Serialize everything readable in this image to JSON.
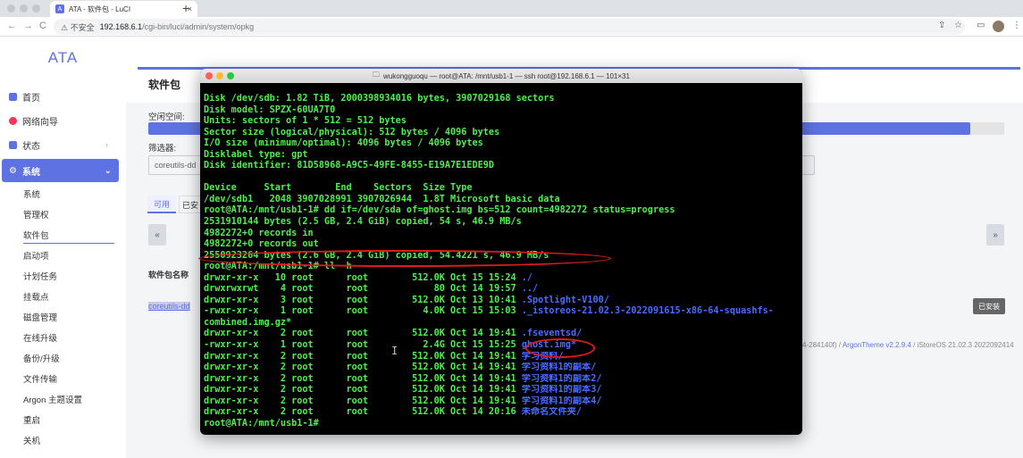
{
  "browser": {
    "tab_title": "ATA - 软件包 - LuCI",
    "favicon": "A",
    "close": "×",
    "new_tab": "+",
    "nav": {
      "back": "←",
      "forward": "→",
      "reload": "C"
    },
    "security_label": "⚠ 不安全",
    "url_host": "192.168.6.1",
    "url_path": "/cgi-bin/luci/admin/system/opkg",
    "icons": [
      "share-icon",
      "star-icon",
      "sidebar-icon",
      "profile-avatar",
      "menu-icon"
    ]
  },
  "sidebar": {
    "brand": "ATA",
    "top_items": [
      {
        "label": "首页",
        "icon": "home-icon",
        "color": "#5e72e4"
      },
      {
        "label": "网络向导",
        "icon": "wizard-icon",
        "color": "#f5365c"
      },
      {
        "label": "状态",
        "icon": "status-icon",
        "color": "#5e72e4"
      }
    ],
    "active_section": "系统",
    "sub_items": [
      "系统",
      "管理权",
      "软件包",
      "启动项",
      "计划任务",
      "挂载点",
      "磁盘管理",
      "在线升级",
      "备份/升级",
      "文件传输",
      "Argon 主题设置",
      "重启",
      "关机"
    ],
    "active_sub": "软件包"
  },
  "main": {
    "title": "软件包",
    "free_space_label": "空闲空间:",
    "free_space_fraction": 0.96,
    "filter_label": "筛选器:",
    "filter_value": "coreutils-dd",
    "tab_available": "可用",
    "tab_installed": "已安",
    "pager_prev": "«",
    "pager_next": "»",
    "col_name": "软件包名称",
    "row_package": "coreutils-dd",
    "installed_badge": "已安装",
    "footer_link": "4-284140f)",
    "footer_theme": "ArgonTheme v2.2.9.4",
    "footer_os": "iStoreOS 21.02.3 2022092414",
    "footer_sep": " / "
  },
  "terminal": {
    "title": "wukongguoqu — root@ATA: /mnt/usb1-1 — ssh root@192.168.6.1 — 101×31",
    "lines": [
      "Disk /dev/sdb: 1.82 TiB, 2000398934016 bytes, 3907029168 sectors",
      "Disk model: SPZX-60UA7T0",
      "Units: sectors of 1 * 512 = 512 bytes",
      "Sector size (logical/physical): 512 bytes / 4096 bytes",
      "I/O size (minimum/optimal): 4096 bytes / 4096 bytes",
      "Disklabel type: gpt",
      "Disk identifier: 81D58968-A9C5-49FE-8455-E19A7E1EDE9D",
      "",
      "Device     Start        End    Sectors  Size Type",
      "/dev/sdb1   2048 3907028991 3907026944  1.8T Microsoft basic data",
      "root@ATA:/mnt/usb1-1# dd if=/dev/sda of=ghost.img bs=512 count=4982272 status=progress",
      "2531910144 bytes (2.5 GB, 2.4 GiB) copied, 54 s, 46.9 MB/s",
      "4982272+0 records in",
      "4982272+0 records out",
      "2550923264 bytes (2.6 GB, 2.4 GiB) copied, 54.4221 s, 46.9 MB/s",
      "root@ATA:/mnt/usb1-1# ll -h"
    ],
    "listing": [
      {
        "perm": "drwxr-xr-x",
        "n": "10",
        "u": "root",
        "g": "root",
        "size": "512.0K",
        "date": "Oct 15 15:24",
        "name": "./"
      },
      {
        "perm": "drwxrwxrwt",
        "n": "4",
        "u": "root",
        "g": "root",
        "size": "80",
        "date": "Oct 14 19:57",
        "name": "../"
      },
      {
        "perm": "drwxr-xr-x",
        "n": "3",
        "u": "root",
        "g": "root",
        "size": "512.0K",
        "date": "Oct 13 10:41",
        "name": ".Spotlight-V100/"
      },
      {
        "perm": "-rwxr-xr-x",
        "n": "1",
        "u": "root",
        "g": "root",
        "size": "4.0K",
        "date": "Oct 15 15:03",
        "name": "._istoreos-21.02.3-2022091615-x86-64-squashfs-"
      },
      {
        "perm": "combined.img.gz*",
        "n": "",
        "u": "",
        "g": "",
        "size": "",
        "date": "",
        "name": ""
      },
      {
        "perm": "drwxr-xr-x",
        "n": "2",
        "u": "root",
        "g": "root",
        "size": "512.0K",
        "date": "Oct 14 19:41",
        "name": ".fseventsd/"
      },
      {
        "perm": "-rwxr-xr-x",
        "n": "1",
        "u": "root",
        "g": "root",
        "size": "2.4G",
        "date": "Oct 15 15:25",
        "name": "ghost.img*"
      },
      {
        "perm": "drwxr-xr-x",
        "n": "2",
        "u": "root",
        "g": "root",
        "size": "512.0K",
        "date": "Oct 14 19:41",
        "name": "学习资料/"
      },
      {
        "perm": "drwxr-xr-x",
        "n": "2",
        "u": "root",
        "g": "root",
        "size": "512.0K",
        "date": "Oct 14 19:41",
        "name": "学习资料1的副本/"
      },
      {
        "perm": "drwxr-xr-x",
        "n": "2",
        "u": "root",
        "g": "root",
        "size": "512.0K",
        "date": "Oct 14 19:41",
        "name": "学习资料1的副本2/"
      },
      {
        "perm": "drwxr-xr-x",
        "n": "2",
        "u": "root",
        "g": "root",
        "size": "512.0K",
        "date": "Oct 14 19:41",
        "name": "学习资料1的副本3/"
      },
      {
        "perm": "drwxr-xr-x",
        "n": "2",
        "u": "root",
        "g": "root",
        "size": "512.0K",
        "date": "Oct 14 19:41",
        "name": "学习资料1的副本4/"
      },
      {
        "perm": "drwxr-xr-x",
        "n": "2",
        "u": "root",
        "g": "root",
        "size": "512.0K",
        "date": "Oct 14 20:16",
        "name": "未命名文件夹/"
      }
    ],
    "prompt": "root@ATA:/mnt/usb1-1#"
  },
  "colors": {
    "accent": "#5e72e4",
    "term_green": "#4cf14c",
    "term_blue": "#4a6cff",
    "annotation_red": "#e01a1a"
  }
}
